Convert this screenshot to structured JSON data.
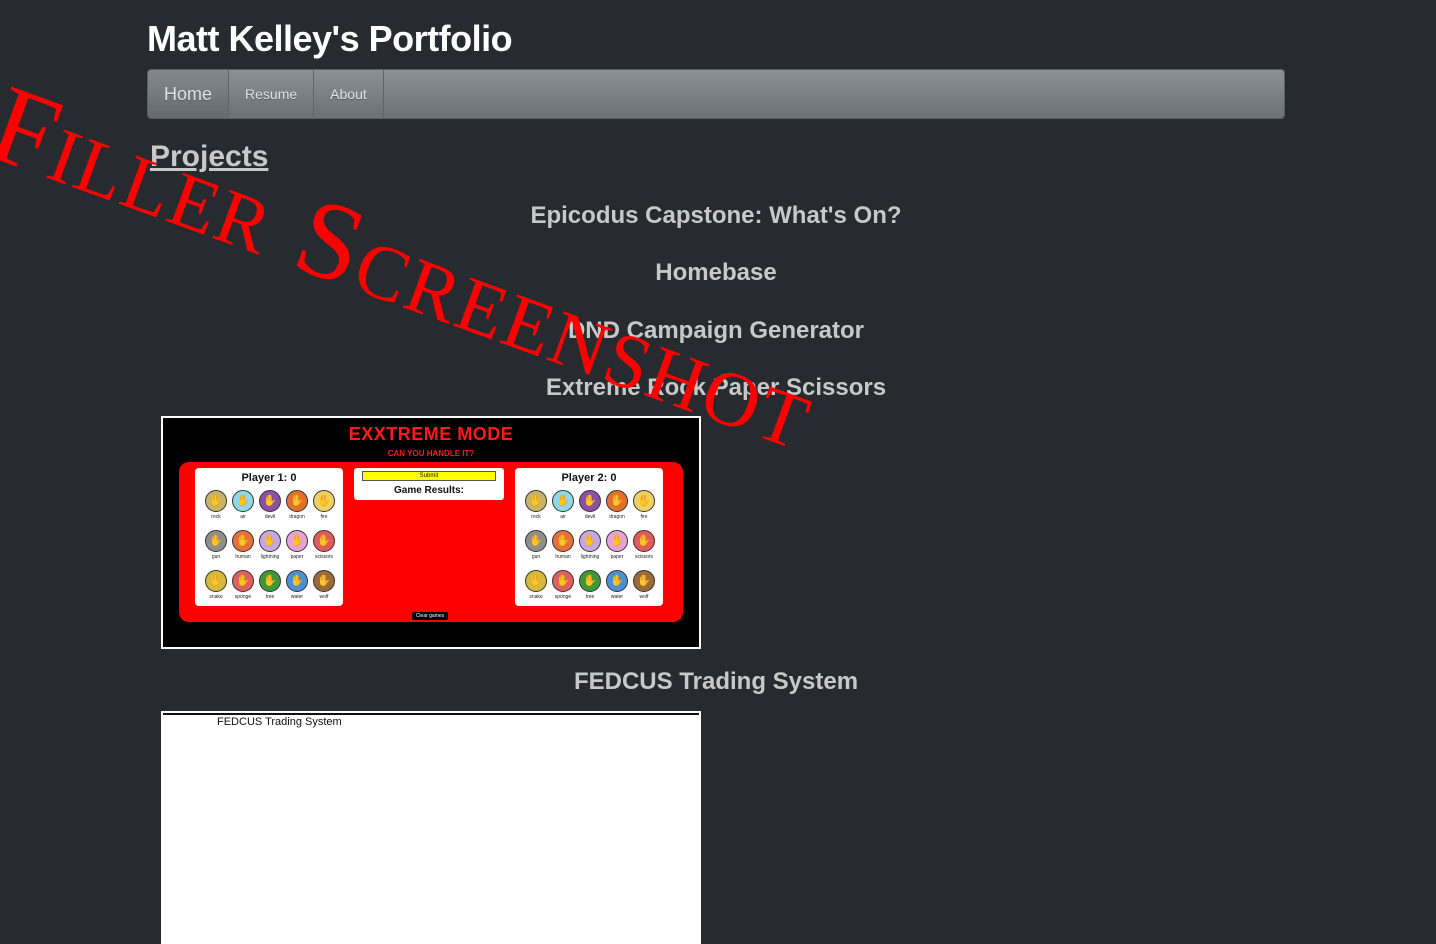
{
  "site": {
    "title": "Matt Kelley's Portfolio"
  },
  "nav": {
    "items": [
      {
        "label": "Home",
        "active": true
      },
      {
        "label": "Resume",
        "active": false
      },
      {
        "label": "About",
        "active": false
      }
    ]
  },
  "main": {
    "section_heading": "Projects",
    "projects": [
      {
        "title": "Epicodus Capstone: What's On?"
      },
      {
        "title": "Homebase"
      },
      {
        "title": "DND Campaign Generator"
      },
      {
        "title": "Extreme Rock Paper Scissors"
      },
      {
        "title": "FEDCUS Trading System"
      }
    ]
  },
  "rps_screenshot": {
    "title": "EXXTREME MODE",
    "subtitle": "CAN YOU HANDLE IT?",
    "player1": "Player 1: 0",
    "player2": "Player 2: 0",
    "submit": "Submit",
    "results": "Game Results:",
    "clear": "Clear games",
    "choices": [
      {
        "label": "rock",
        "color": "#c9b26a"
      },
      {
        "label": "air",
        "color": "#8fd8e8"
      },
      {
        "label": "devil",
        "color": "#8b4fa8"
      },
      {
        "label": "dragon",
        "color": "#e0702a"
      },
      {
        "label": "fire",
        "color": "#f0d060"
      },
      {
        "label": "gun",
        "color": "#8e8e8e"
      },
      {
        "label": "human",
        "color": "#e86f3a"
      },
      {
        "label": "lightning",
        "color": "#c9a6e6"
      },
      {
        "label": "paper",
        "color": "#e7a3d6"
      },
      {
        "label": "scissors",
        "color": "#e25a5a"
      },
      {
        "label": "snake",
        "color": "#d6b83c"
      },
      {
        "label": "sponge",
        "color": "#e06060"
      },
      {
        "label": "tree",
        "color": "#3a9a3a"
      },
      {
        "label": "water",
        "color": "#4a8fd8"
      },
      {
        "label": "wolf",
        "color": "#9a6a3a"
      }
    ]
  },
  "fedcus_screenshot": {
    "label": "FEDCUS Trading System"
  },
  "watermark": {
    "text": "Filler Screenshot"
  }
}
